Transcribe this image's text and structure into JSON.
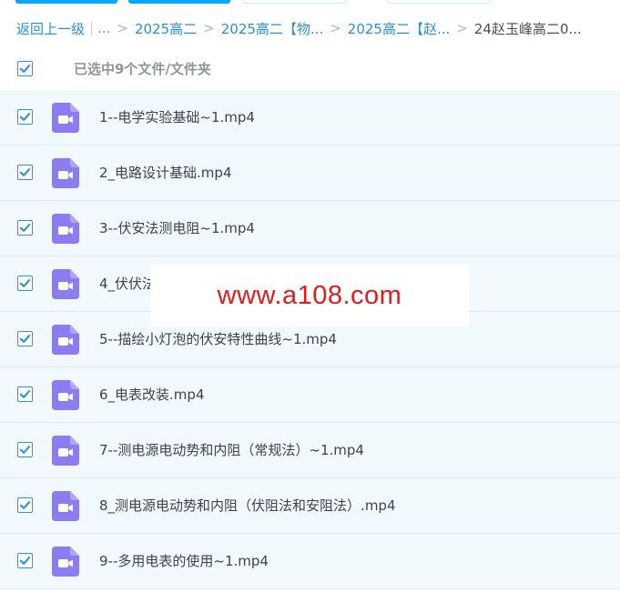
{
  "breadcrumb": {
    "back_label": "返回上一级",
    "ellipsis": "...",
    "items": [
      "2025高二",
      "2025高二【物...",
      "2025高二【赵..."
    ],
    "current": "24赵玉峰高二0..."
  },
  "selection": {
    "label": "已选中9个文件/文件夹",
    "all_checked": true
  },
  "files": [
    {
      "name": "1--电学实验基础~1.mp4",
      "icon": "video-file-icon",
      "checked": true
    },
    {
      "name": "2_电路设计基础.mp4",
      "icon": "video-file-icon",
      "checked": true
    },
    {
      "name": "3--伏安法测电阻~1.mp4",
      "icon": "video-file-icon",
      "checked": true
    },
    {
      "name": "4_伏伏法",
      "icon": "video-file-icon",
      "checked": true
    },
    {
      "name": "5--描绘小灯泡的伏安特性曲线~1.mp4",
      "icon": "video-file-icon",
      "checked": true
    },
    {
      "name": "6_电表改装.mp4",
      "icon": "video-file-icon",
      "checked": true
    },
    {
      "name": "7--测电源电动势和内阻（常规法）~1.mp4",
      "icon": "video-file-icon",
      "checked": true
    },
    {
      "name": "8_测电源电动势和内阻（伏阻法和安阻法）.mp4",
      "icon": "video-file-icon",
      "checked": true
    },
    {
      "name": "9--多用电表的使用~1.mp4",
      "icon": "video-file-icon",
      "checked": true
    }
  ],
  "watermark": {
    "text": "www.a108.com"
  },
  "colors": {
    "accent": "#2a95d8",
    "link": "#2a8fd6",
    "video_icon": "#8b7cf2",
    "row_bg": "#f2f9fd",
    "watermark": "#e21b1b"
  }
}
